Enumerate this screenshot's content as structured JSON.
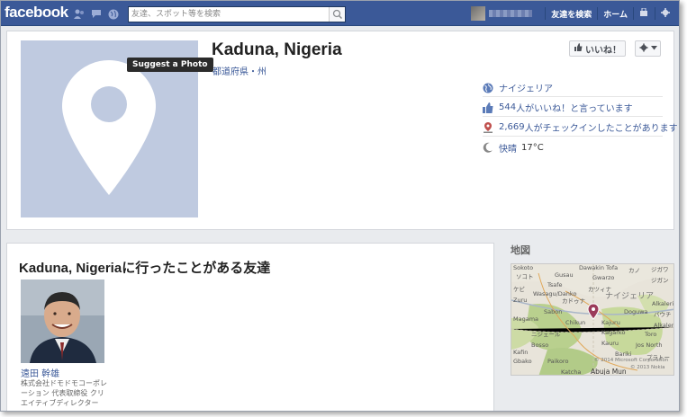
{
  "topbar": {
    "logo": "facebook",
    "search_placeholder": "友達、スポット等を検索",
    "find_friends": "友達を検索",
    "home": "ホーム"
  },
  "place": {
    "name": "Kaduna, Nigeria",
    "category": "都道府県・州",
    "suggest_photo": "Suggest a Photo",
    "like_button": "いいね！",
    "country": "ナイジェリア",
    "likes_count": "544",
    "likes_text": "人がいいね！と言っています",
    "checkins_count": "2,669",
    "checkins_text": "人がチェックインしたことがあります",
    "weather_condition": "快晴",
    "temperature": "17°C"
  },
  "friends": {
    "heading": "Kaduna, Nigeriaに行ったことがある友達",
    "items": [
      {
        "name": "遠田 幹雄",
        "description": "株式会社ドモドモコーポレーション 代表取締役 クリエイティブディレクター"
      }
    ]
  },
  "map": {
    "label": "地図",
    "copyright_1": "© 2014 Microsoft Corporation",
    "copyright_2": "© 2013 Nokia",
    "places": [
      "Sokoto",
      "Dawakin Tofa",
      "カノ",
      "ジガワ",
      "Gusau",
      "ソコト",
      "Gwarzo",
      "Tsafe",
      "ジガン",
      "カツィナ",
      "ケビ",
      "Wasagu/Danko",
      "Zuru",
      "カドゥナ",
      "Sabon",
      "Chikun",
      "Kajuru",
      "Doguwa",
      "バウチ",
      "Alkalere",
      "Magama",
      "Kagarko",
      "Kauru",
      "Toro",
      "ニジェール",
      "Bosso",
      "Kafin",
      "Jos North",
      "Gbako",
      "Katcha",
      "Abuja Mun",
      "Paikoro",
      "プラトー",
      "ナイジェリア",
      "Bariki",
      "Alkaleri"
    ]
  },
  "colors": {
    "brand": "#3b5998",
    "photo_placeholder": "#bfcae0"
  }
}
